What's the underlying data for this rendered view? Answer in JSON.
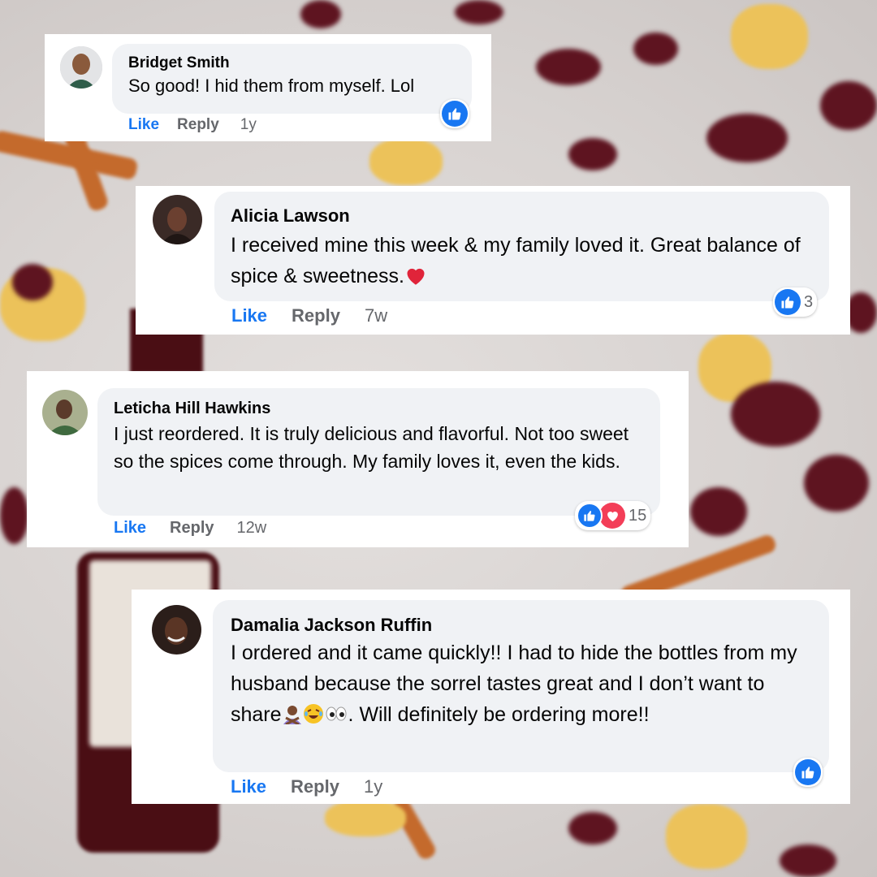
{
  "comments": [
    {
      "author": "Bridget Smith",
      "text": "So good! I hid them from myself. Lol",
      "actions": {
        "like": "Like",
        "reply": "Reply",
        "time": "1y"
      },
      "reactions": {
        "icons": [
          "like-icon"
        ],
        "count": ""
      }
    },
    {
      "author": "Alicia Lawson",
      "text": "I received mine this week & my family loved it. Great balance of spice & sweetness.",
      "emoji": "heart",
      "actions": {
        "like": "Like",
        "reply": "Reply",
        "time": "7w"
      },
      "reactions": {
        "icons": [
          "like-icon"
        ],
        "count": "3"
      }
    },
    {
      "author": "Leticha Hill Hawkins",
      "text": "I just reordered. It is truly delicious and flavorful. Not too sweet so the spices come through. My family loves it, even the kids.",
      "actions": {
        "like": "Like",
        "reply": "Reply",
        "time": "12w"
      },
      "reactions": {
        "icons": [
          "like-icon",
          "love-icon"
        ],
        "count": "15"
      }
    },
    {
      "author": "Damalia Jackson Ruffin",
      "text_before_emoji": "I ordered and it came quickly!! I had to hide the bottles from my husband because the sorrel tastes great and I don’t want to share",
      "emojis": [
        "person-gesturing-no",
        "laughing-face",
        "eyes"
      ],
      "text_after_emoji": ". Will definitely be ordering more!!",
      "actions": {
        "like": "Like",
        "reply": "Reply",
        "time": "1y"
      },
      "reactions": {
        "icons": [
          "like-icon"
        ],
        "count": ""
      }
    }
  ],
  "colors": {
    "like_blue": "#1877f2",
    "love_red": "#f33e58",
    "bubble": "#f0f2f5",
    "meta_gray": "#65676b"
  }
}
